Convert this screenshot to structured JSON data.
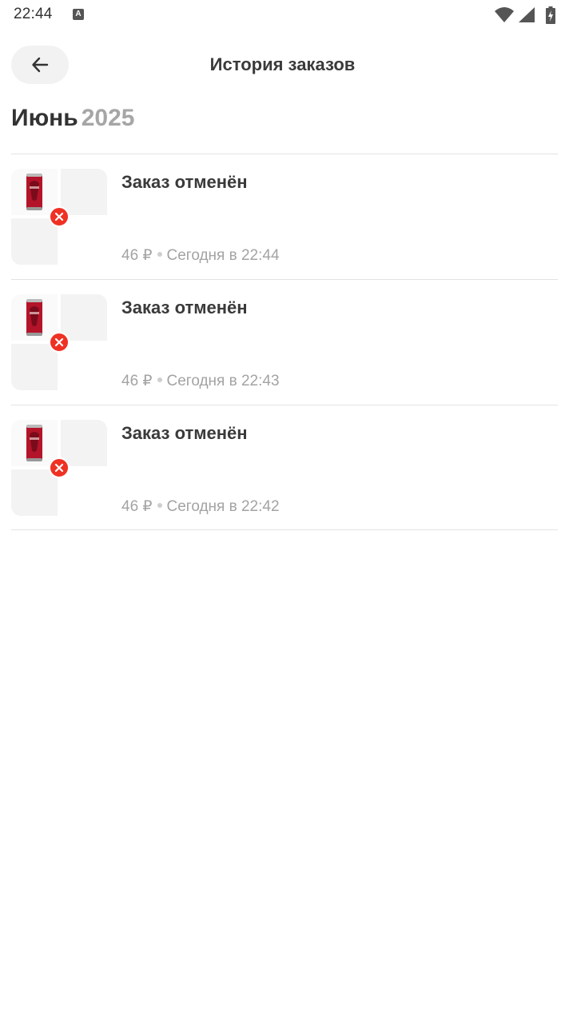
{
  "status_bar": {
    "time": "22:44",
    "notification_icon": "a-letter-icon",
    "icons": [
      "wifi-icon",
      "signal-icon",
      "battery-charging-icon"
    ]
  },
  "header": {
    "back_icon": "arrow-left-icon",
    "title": "История заказов"
  },
  "section": {
    "month": "Июнь",
    "year": "2025"
  },
  "orders": [
    {
      "status": "Заказ отменён",
      "price": "46 ₽",
      "time": "Сегодня в 22:44",
      "badge": "cancel-icon"
    },
    {
      "status": "Заказ отменён",
      "price": "46 ₽",
      "time": "Сегодня в 22:43",
      "badge": "cancel-icon"
    },
    {
      "status": "Заказ отменён",
      "price": "46 ₽",
      "time": "Сегодня в 22:42",
      "badge": "cancel-icon"
    }
  ],
  "colors": {
    "cancel_badge": "#ef3124",
    "muted_text": "#a3a3a3",
    "primary_text": "#3a3a3a",
    "divider": "#e3e3e3"
  }
}
